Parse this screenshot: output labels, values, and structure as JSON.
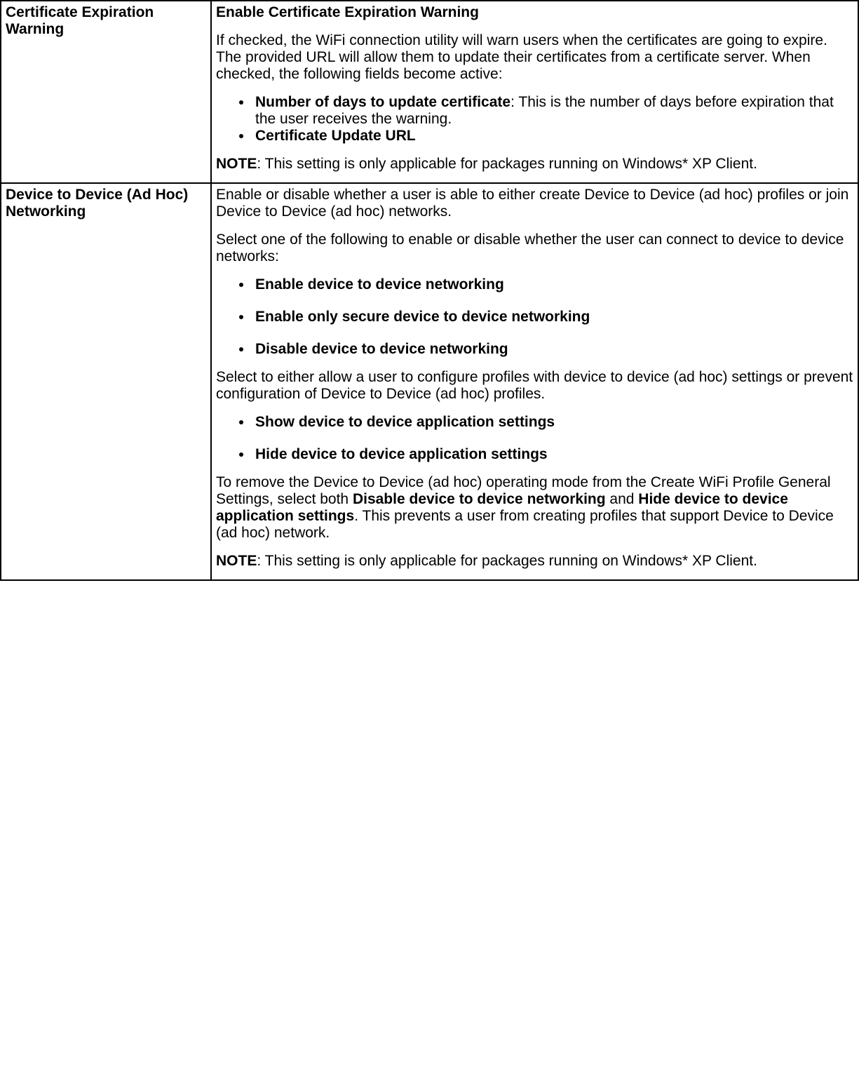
{
  "row1": {
    "label": "Certificate Expiration Warning",
    "title": "Enable Certificate Expiration Warning",
    "p1": "If checked, the WiFi connection utility will warn users when the certificates are going to expire. The provided URL will allow them to update their certificates from a certificate server. When checked, the following fields become active:",
    "bullet1_bold": "Number of days to update certificate",
    "bullet1_rest": ": This is the number of days before expiration that the user receives the warning.",
    "bullet2": "Certificate Update URL",
    "note_label": "NOTE",
    "note_text": ": This setting is only applicable for packages running on Windows* XP Client."
  },
  "row2": {
    "label": "Device to Device (Ad Hoc) Networking",
    "p1": "Enable or disable whether a user is able to either create Device to Device (ad hoc) profiles or join Device to Device (ad hoc) networks.",
    "p2": "Select one of the following to enable or disable whether the user can connect to device to device networks:",
    "list1": [
      "Enable device to device networking",
      "Enable only secure device to device networking",
      "Disable device to device networking"
    ],
    "p3": "Select to either allow a user to configure profiles with device to device (ad hoc) settings or prevent configuration of Device to Device (ad hoc) profiles.",
    "list2": [
      "Show device to device application settings",
      "Hide device to device application settings"
    ],
    "p4_part1": "To remove the Device to Device (ad hoc) operating mode from the Create WiFi Profile General Settings, select both ",
    "p4_bold1": "Disable device to device networking",
    "p4_part2": " and ",
    "p4_bold2": "Hide device to device application settings",
    "p4_part3": ". This prevents a user from creating profiles that support Device to Device (ad hoc) network.",
    "note_label": "NOTE",
    "note_text": ": This setting is only applicable for packages running on Windows* XP Client."
  }
}
